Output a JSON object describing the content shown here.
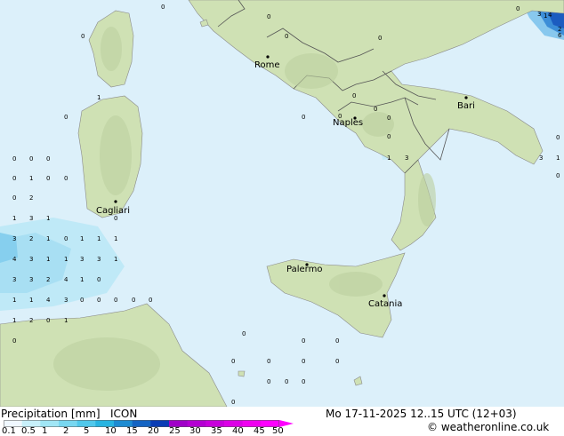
{
  "map": {
    "cities": [
      {
        "name": "Rome"
      },
      {
        "name": "Naples"
      },
      {
        "name": "Bari"
      },
      {
        "name": "Cagliari"
      },
      {
        "name": "Palermo"
      },
      {
        "name": "Catania"
      }
    ],
    "precip_values": [
      "0",
      "0",
      "0",
      "1",
      "0",
      "0",
      "0",
      "0",
      "0",
      "0",
      "0",
      "0",
      "0",
      "1",
      "0",
      "0",
      "0",
      "2",
      "1",
      "3",
      "1",
      "0",
      "3",
      "2",
      "1",
      "0",
      "1",
      "1",
      "1",
      "4",
      "3",
      "1",
      "1",
      "3",
      "3",
      "1",
      "3",
      "3",
      "2",
      "4",
      "1",
      "0",
      "1",
      "1",
      "4",
      "3",
      "0",
      "0",
      "0",
      "0",
      "0",
      "1",
      "2",
      "0",
      "1",
      "0",
      "0",
      "0",
      "0",
      "0",
      "0",
      "0",
      "0",
      "0",
      "0",
      "0",
      "0",
      "0",
      "0",
      "0",
      "0",
      "1",
      "3",
      "0",
      "1",
      "3",
      "0",
      "0",
      "3",
      "1",
      "4",
      "6",
      "2"
    ]
  },
  "legend": {
    "title": "Precipitation [mm]",
    "model": "ICON",
    "ticks": [
      "0.1",
      "0.5",
      "1",
      "2",
      "5",
      "10",
      "15",
      "20",
      "25",
      "30",
      "35",
      "40",
      "45",
      "50"
    ],
    "colors": [
      "#f0f8ff",
      "#c8f0fa",
      "#a0e6f5",
      "#78d7f0",
      "#50c8eb",
      "#28b4e1",
      "#1e8cd2",
      "#1464c3",
      "#0a3cb4",
      "#a000c8",
      "#b400d2",
      "#c800dc",
      "#dc00e6",
      "#f000f0",
      "#ff00ff"
    ]
  },
  "timestamp": "Mo 17-11-2025 12..15 UTC (12+03)",
  "credit": "© weatheronline.co.uk"
}
